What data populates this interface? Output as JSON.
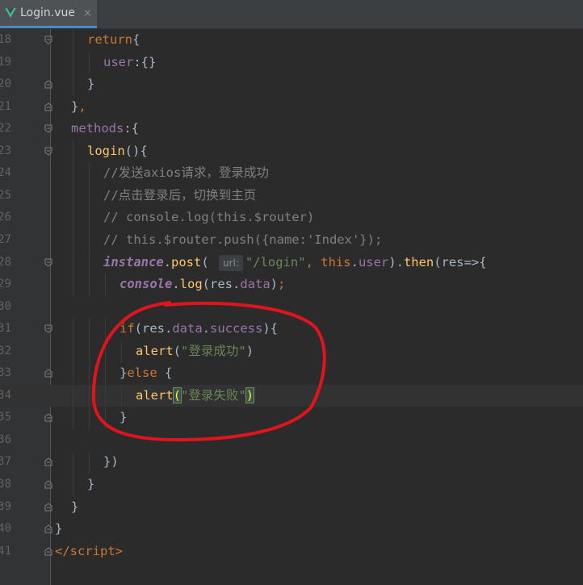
{
  "tab": {
    "filename": "Login.vue",
    "close_glyph": "×",
    "icon": "vue-icon"
  },
  "lines": [
    {
      "num": "18",
      "indent": 2,
      "html": "<span class='kw'>return</span>{"
    },
    {
      "num": "19",
      "indent": 3,
      "html": "<span class='prop'>user</span>:{}"
    },
    {
      "num": "20",
      "indent": 2,
      "html": "}"
    },
    {
      "num": "21",
      "indent": 1,
      "html": "}<span class='kw'>,</span>"
    },
    {
      "num": "22",
      "indent": 1,
      "html": "<span class='prop'>methods</span>:{"
    },
    {
      "num": "23",
      "indent": 2,
      "html": "<span class='fn'>login</span>(){"
    },
    {
      "num": "24",
      "indent": 3,
      "html": "<span class='cmt'>//发送axios请求，登录成功</span>"
    },
    {
      "num": "25",
      "indent": 3,
      "html": "<span class='cmt'>//点击登录后，切换到主页</span>"
    },
    {
      "num": "26",
      "indent": 3,
      "html": "<span class='cmt'>// console.log(this.$router)</span>"
    },
    {
      "num": "27",
      "indent": 3,
      "html": "<span class='cmt'>// this.$router.push({name:'Index'});</span>"
    },
    {
      "num": "28",
      "indent": 3,
      "html": "<span class='ital'>instance</span>.<span class='fn'>post</span>( <span class='hint'>url:</span><span class='str'>\"/login\"</span><span class='kw'>,</span> <span class='kw'>this</span>.<span class='prop'>user</span>).<span class='fn'>then</span>(res=>{"
    },
    {
      "num": "29",
      "indent": 4,
      "html": "<span class='ital'>console</span>.<span class='fn'>log</span>(res.<span class='prop'>data</span>)<span class='kw'>;</span>"
    },
    {
      "num": "30",
      "indent": 0,
      "html": ""
    },
    {
      "num": "31",
      "indent": 4,
      "html": "<span class='kw'>if</span>(res.<span class='prop'>data</span>.<span class='prop'>success</span>){"
    },
    {
      "num": "32",
      "indent": 5,
      "html": "<span class='fn'>alert</span>(<span class='str'>\"登录成功\"</span>)"
    },
    {
      "num": "33",
      "indent": 4,
      "html": "}<span class='kw'>else</span> {"
    },
    {
      "num": "34",
      "indent": 5,
      "html": "<span class='fn'>alert</span><span class='brace-match'>(</span><span class='str'>\"登录失败\"</span><span class='brace-match'>)</span>",
      "current": true
    },
    {
      "num": "35",
      "indent": 4,
      "html": "}"
    },
    {
      "num": "36",
      "indent": 0,
      "html": ""
    },
    {
      "num": "37",
      "indent": 3,
      "html": "})"
    },
    {
      "num": "38",
      "indent": 2,
      "html": "}"
    },
    {
      "num": "39",
      "indent": 1,
      "html": "}"
    },
    {
      "num": "40",
      "indent": 0,
      "html": "}"
    },
    {
      "num": "41",
      "indent": 0,
      "html": "<span class='kw'>&lt;/script&gt;</span>"
    }
  ],
  "colors": {
    "background": "#2b2b2b",
    "gutter": "#313335",
    "keyword": "#cc7832",
    "property": "#9876aa",
    "function": "#ffc66d",
    "string": "#6a8759",
    "comment": "#808080",
    "annotation_circle": "#e0141c"
  }
}
